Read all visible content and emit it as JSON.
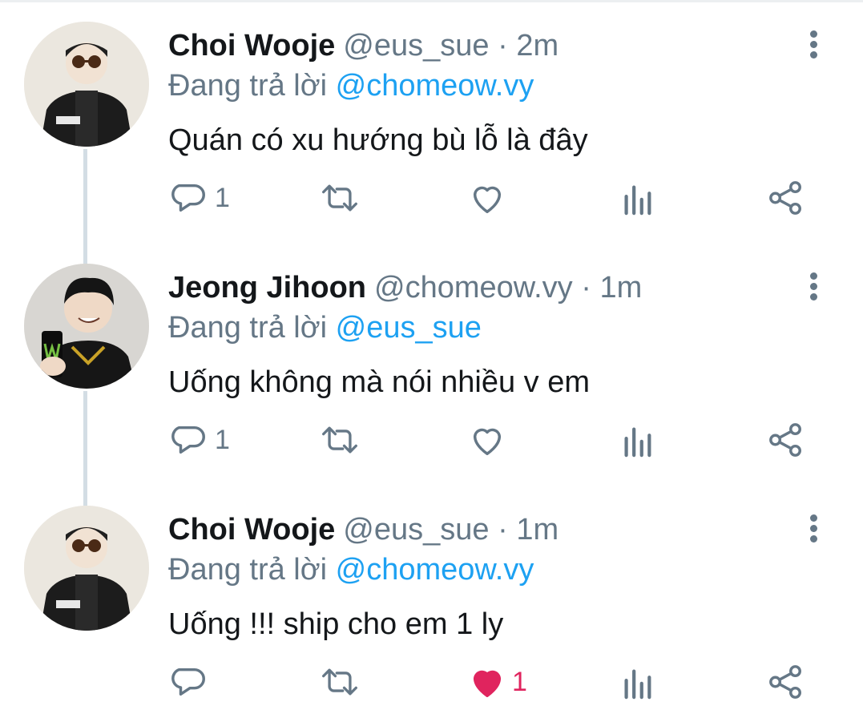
{
  "tweets": [
    {
      "avatar_icon": "avatar-sunglasses-icon",
      "name": "Choi Wooje",
      "handle": "@eus_sue",
      "separator": "·",
      "time": "2m",
      "replying_prefix": "Đang trả lời",
      "replying_to": "@chomeow.vy",
      "text": "Quán có xu hướng bù lỗ là đây",
      "reply_count": "1",
      "like_count": "",
      "liked": false
    },
    {
      "avatar_icon": "avatar-energy-drink-icon",
      "name": "Jeong Jihoon",
      "handle": "@chomeow.vy",
      "separator": "·",
      "time": "1m",
      "replying_prefix": "Đang trả lời",
      "replying_to": "@eus_sue",
      "text": "Uống không mà nói nhiều v em",
      "reply_count": "1",
      "like_count": "",
      "liked": false
    },
    {
      "avatar_icon": "avatar-sunglasses-icon",
      "name": "Choi Wooje",
      "handle": "@eus_sue",
      "separator": "·",
      "time": "1m",
      "replying_prefix": "Đang trả lời",
      "replying_to": "@chomeow.vy",
      "text": "Uống !!! ship cho em 1 ly",
      "reply_count": "",
      "like_count": "1",
      "liked": true
    }
  ],
  "icons": {
    "reply": "reply-icon",
    "retweet": "retweet-icon",
    "like": "heart-icon",
    "analytics": "analytics-icon",
    "share": "share-icon",
    "more": "more-vertical-icon"
  },
  "colors": {
    "accent": "#1da1f2",
    "secondary_text": "#657786",
    "primary_text": "#14171a",
    "like_active": "#e0245e",
    "thread_line": "#d3dde4"
  }
}
